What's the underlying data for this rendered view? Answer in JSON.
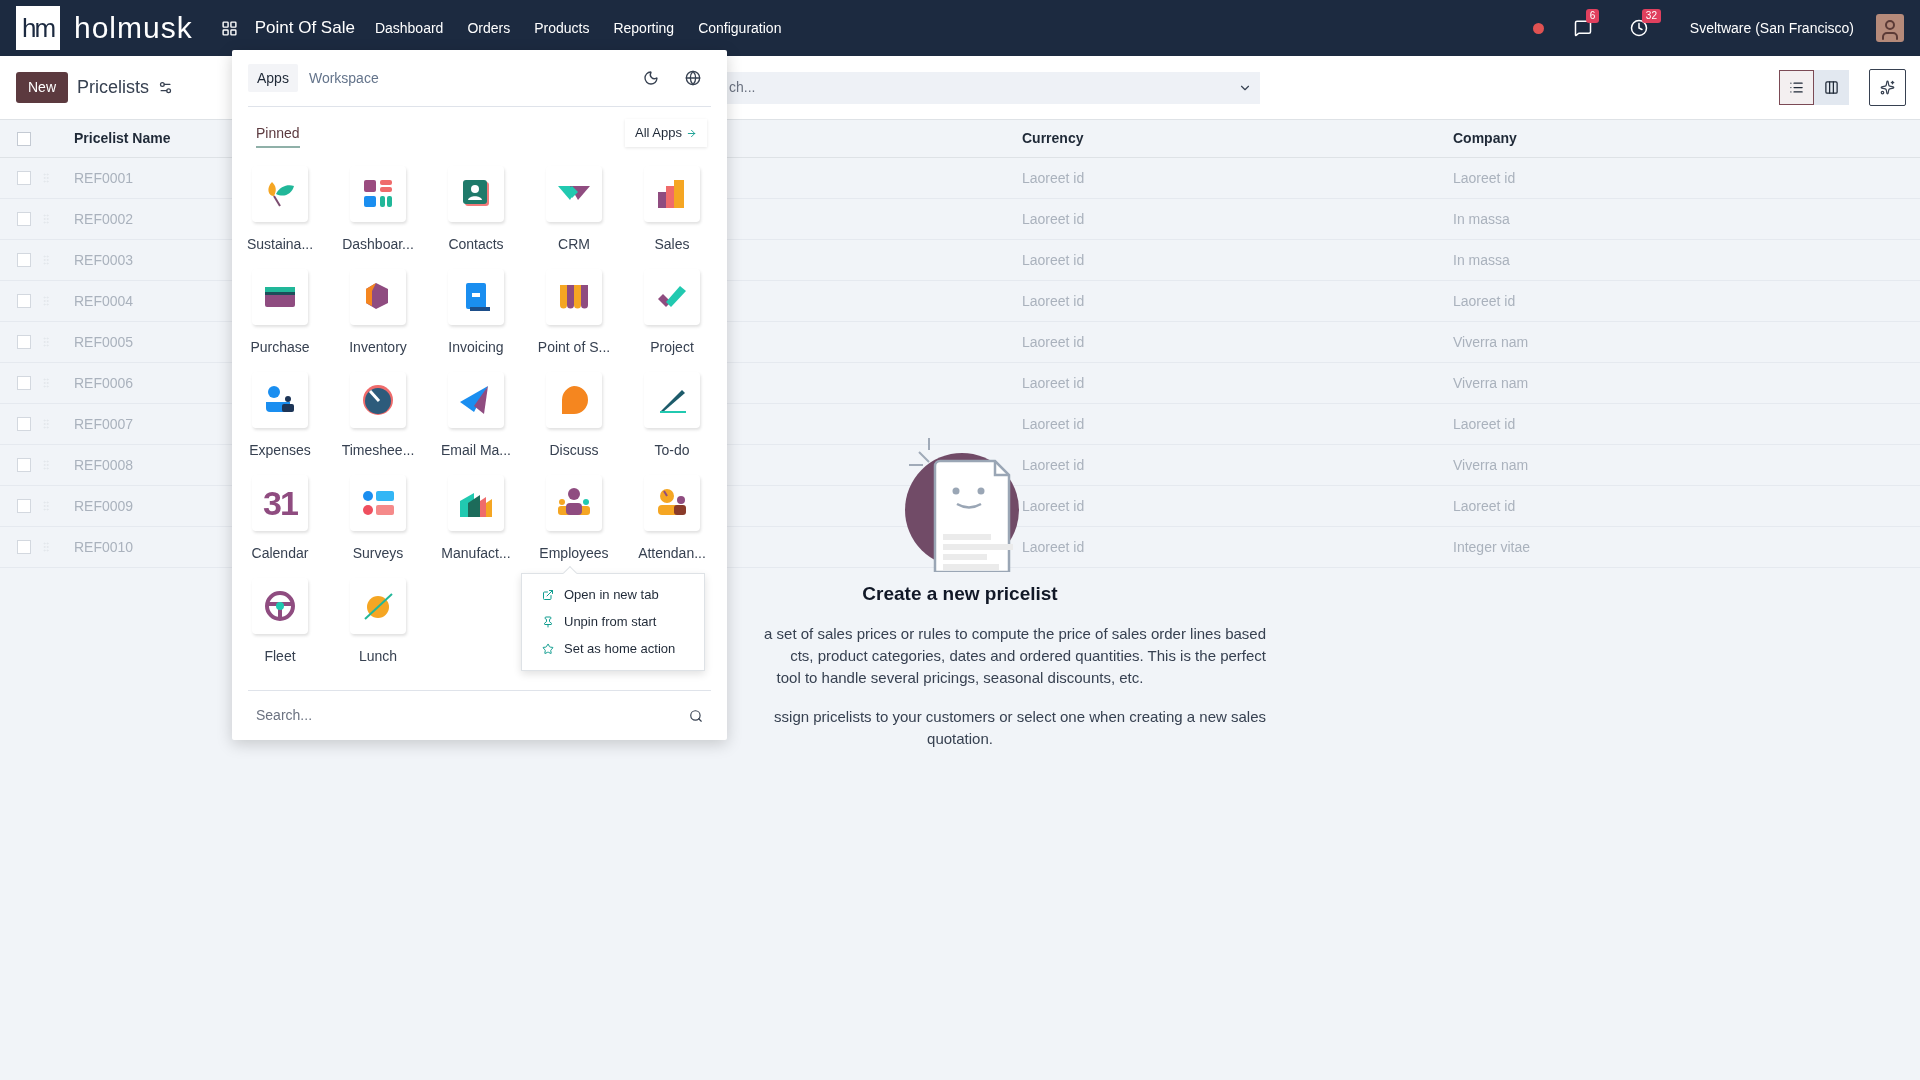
{
  "topbar": {
    "logo_mark": "hm",
    "brand": "holmusk",
    "app_title": "Point Of Sale",
    "nav": [
      {
        "label": "Dashboard"
      },
      {
        "label": "Orders"
      },
      {
        "label": "Products"
      },
      {
        "label": "Reporting"
      },
      {
        "label": "Configuration"
      }
    ],
    "messages_badge": "6",
    "activities_badge": "32",
    "company": "Sveltware (San Francisco)"
  },
  "control_bar": {
    "new_button": "New",
    "title": "Pricelists",
    "search_visible_text": "ch...",
    "views": [
      {
        "kind": "list",
        "selected": true
      },
      {
        "kind": "kanban",
        "selected": false
      }
    ]
  },
  "table": {
    "select_all_checked": false,
    "columns": [
      "Pricelist Name",
      "Currency",
      "Company"
    ],
    "rows": [
      {
        "checked": false,
        "name": "REF0001",
        "currency": "Laoreet id",
        "company": "Laoreet id"
      },
      {
        "checked": false,
        "name": "REF0002",
        "currency": "Laoreet id",
        "company": "In massa"
      },
      {
        "checked": false,
        "name": "REF0003",
        "currency": "Laoreet id",
        "company": "In massa"
      },
      {
        "checked": false,
        "name": "REF0004",
        "currency": "Laoreet id",
        "company": "Laoreet id"
      },
      {
        "checked": false,
        "name": "REF0005",
        "currency": "Laoreet id",
        "company": "Viverra nam"
      },
      {
        "checked": false,
        "name": "REF0006",
        "currency": "Laoreet id",
        "company": "Viverra nam"
      },
      {
        "checked": false,
        "name": "REF0007",
        "currency": "Laoreet id",
        "company": "Laoreet id"
      },
      {
        "checked": false,
        "name": "REF0008",
        "currency": "Laoreet id",
        "company": "Viverra nam"
      },
      {
        "checked": false,
        "name": "REF0009",
        "currency": "Laoreet id",
        "company": "Laoreet id"
      },
      {
        "checked": false,
        "name": "REF0010",
        "currency": "Laoreet id",
        "company": "Integer vitae"
      }
    ]
  },
  "empty_state": {
    "title": "Create a new pricelist",
    "lines": [
      {
        "kind": "cut",
        "text": "a set of sales prices or rules to compute the price of sales order lines based"
      },
      {
        "kind": "cut",
        "text": "cts, product categories, dates and ordered quantities. This is the perfect"
      },
      {
        "kind": "whole",
        "text": "tool to handle several pricings, seasonal discounts, etc."
      },
      {
        "kind": "gap"
      },
      {
        "kind": "cut",
        "text": "ssign pricelists to your customers or select one when creating a new sales"
      },
      {
        "kind": "whole",
        "text": "quotation."
      }
    ]
  },
  "app_menu": {
    "tabs": [
      {
        "label": "Apps",
        "selected": true
      },
      {
        "label": "Workspace",
        "selected": false
      }
    ],
    "sections": [
      {
        "label": "Pinned",
        "selected": true
      }
    ],
    "all_apps_button": "All Apps",
    "apps": [
      {
        "label": "Sustaina..."
      },
      {
        "label": "Dashboar..."
      },
      {
        "label": "Contacts"
      },
      {
        "label": "CRM"
      },
      {
        "label": "Sales"
      },
      {
        "label": "Purchase"
      },
      {
        "label": "Inventory"
      },
      {
        "label": "Invoicing"
      },
      {
        "label": "Point of S..."
      },
      {
        "label": "Project"
      },
      {
        "label": "Expenses"
      },
      {
        "label": "Timeshee..."
      },
      {
        "label": "Email Ma..."
      },
      {
        "label": "Discuss"
      },
      {
        "label": "To-do"
      },
      {
        "label": "Calendar",
        "icon_text": "31"
      },
      {
        "label": "Surveys"
      },
      {
        "label": "Manufact..."
      },
      {
        "label": "Employees",
        "context_menu": [
          {
            "kind": "open",
            "label": "Open in new tab"
          },
          {
            "kind": "unpin",
            "label": "Unpin from start"
          },
          {
            "kind": "home",
            "label": "Set as home action"
          }
        ]
      },
      {
        "label": "Attendan..."
      },
      {
        "label": "Fleet"
      },
      {
        "label": "Lunch"
      }
    ],
    "search_placeholder": "Search..."
  }
}
